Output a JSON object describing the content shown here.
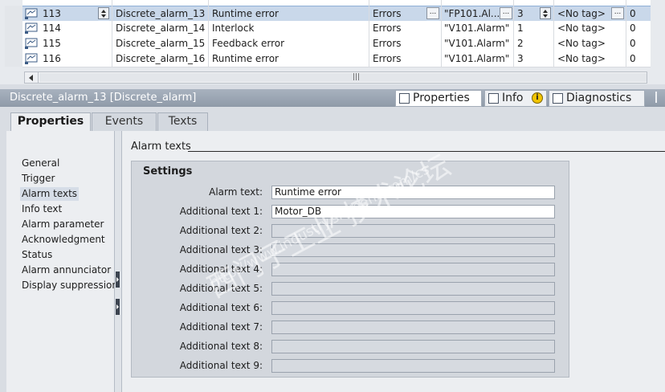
{
  "table": {
    "rows": [
      {
        "id": "113",
        "name": "Discrete_alarm_13",
        "text": "Runtime error",
        "class": "Errors",
        "trigger_tag": "\"FP101.Al...",
        "bit": "3",
        "ack_tag": "<No tag>",
        "ack_bit": "0",
        "selected": true
      },
      {
        "id": "114",
        "name": "Discrete_alarm_14",
        "text": "Interlock",
        "class": "Errors",
        "trigger_tag": "\"V101.Alarm\"",
        "bit": "1",
        "ack_tag": "<No tag>",
        "ack_bit": "0"
      },
      {
        "id": "115",
        "name": "Discrete_alarm_15",
        "text": "Feedback error",
        "class": "Errors",
        "trigger_tag": "\"V101.Alarm\"",
        "bit": "2",
        "ack_tag": "<No tag>",
        "ack_bit": "0"
      },
      {
        "id": "116",
        "name": "Discrete_alarm_16",
        "text": "Runtime error",
        "class": "Errors",
        "trigger_tag": "\"V101.Alarm\"",
        "bit": "3",
        "ack_tag": "<No tag>",
        "ack_bit": "0"
      }
    ],
    "scroll_grip": "|||",
    "dots": "..."
  },
  "inspector": {
    "title": "Discrete_alarm_13 [Discrete_alarm]",
    "tabs": {
      "properties": "Properties",
      "info": "Info",
      "diagnostics": "Diagnostics"
    }
  },
  "property_tabs": {
    "properties": "Properties",
    "events": "Events",
    "texts": "Texts"
  },
  "nav": {
    "items": [
      "General",
      "Trigger",
      "Alarm texts",
      "Info text",
      "Alarm parameter",
      "Acknowledgment",
      "Status",
      "Alarm annunciator",
      "Display suppression"
    ],
    "active_index": 2
  },
  "content": {
    "section_title": "Alarm texts",
    "settings_title": "Settings",
    "fields": [
      {
        "label": "Alarm text:",
        "value": "Runtime error"
      },
      {
        "label": "Additional text 1:",
        "value": "Motor_DB"
      },
      {
        "label": "Additional text 2:",
        "value": ""
      },
      {
        "label": "Additional text 3:",
        "value": ""
      },
      {
        "label": "Additional text 4:",
        "value": ""
      },
      {
        "label": "Additional text 5:",
        "value": ""
      },
      {
        "label": "Additional text 6:",
        "value": ""
      },
      {
        "label": "Additional text 7:",
        "value": ""
      },
      {
        "label": "Additional text 8:",
        "value": ""
      },
      {
        "label": "Additional text 9:",
        "value": ""
      }
    ]
  },
  "watermark": {
    "cn": "西门子工业 技术论坛",
    "url": "http://www.industry.siemens.com/cs"
  },
  "colors": {
    "selected_row": "#c9d8ea",
    "inspector_bar": "#9aa5b3",
    "panel": "#eceef1",
    "settings_box": "#d3d7dd"
  },
  "icons": [
    "alarm-row-icon",
    "spin-arrows-icon",
    "ellipsis-icon",
    "scroll-left-icon",
    "properties-icon",
    "info-icon",
    "info-badge-icon",
    "diagnostics-icon",
    "collapse-arrow-icon"
  ]
}
